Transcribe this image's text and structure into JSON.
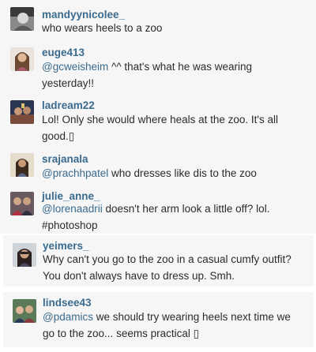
{
  "comments": [
    {
      "username": "mandyynicolee_",
      "lines": [
        "who wears heels to a zoo"
      ]
    },
    {
      "username": "euge413",
      "mention": "@gcweisheim",
      "lines": [
        " ^^ that's what he was wearing",
        "yesterday!!"
      ]
    },
    {
      "username": "ladream22",
      "lines": [
        "Lol! Only she would where heals at the zoo. It's all",
        "good.▯"
      ]
    },
    {
      "username": "srajanala",
      "mention": "@prachhpatel",
      "lines": [
        " who dresses like dis to the zoo"
      ]
    },
    {
      "username": "julie_anne_",
      "mention": "@lorenaadrii",
      "lines": [
        " doesn't her arm look a little off? lol.",
        "#photoshop"
      ]
    },
    {
      "username": "yeimers_",
      "lines": [
        "Why can't you go to the zoo in a casual cumfy outfit?",
        "You don't always have to dress up. Smh."
      ]
    },
    {
      "username": "lindsee43",
      "mention": "@pdamics",
      "lines": [
        " we should try wearing heels next time we",
        "go to the zoo... seems practical ▯"
      ]
    }
  ],
  "icons": {
    "avatar": "user-avatar"
  },
  "colors": {
    "username": "#3a6b8f",
    "text": "#2b2b2b",
    "panel": "#f6f6f6"
  }
}
